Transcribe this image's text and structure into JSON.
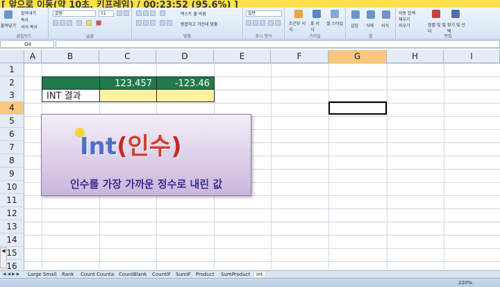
{
  "recording_title": "[ 앞으로 이동(약 10초, 키프레임) / 00:23:52 (95.6%) ]",
  "ribbon": {
    "clipboard": {
      "paste": "붙여넣기",
      "cut": "잘라내기",
      "copy": "복사",
      "format_painter": "서식 복사",
      "label": "클립보드"
    },
    "font": {
      "font_name": "굴림",
      "font_size": "11",
      "label": "글꼴"
    },
    "alignment": {
      "wrap_text": "텍스트 줄 바꿈",
      "merge_center": "병합하고 가운데 맞춤",
      "label": "맞춤"
    },
    "number": {
      "format": "일반",
      "label": "표시 형식"
    },
    "styles": {
      "conditional": "조건부 서식",
      "table": "표 서식",
      "cell": "셀 스타일",
      "label": "스타일"
    },
    "cells": {
      "insert": "삽입",
      "delete": "삭제",
      "format": "서식",
      "label": "셀"
    },
    "editing": {
      "autosum": "자동 합계",
      "fill": "채우기",
      "clear": "지우기",
      "sort": "정렬 및 필터",
      "find": "찾기 및 선택",
      "label": "편집"
    }
  },
  "formula_bar": {
    "name_box": "G4",
    "formula": ""
  },
  "columns": [
    "A",
    "B",
    "C",
    "D",
    "E",
    "F",
    "G",
    "H",
    "I"
  ],
  "rows": [
    "1",
    "2",
    "3",
    "4",
    "5",
    "6",
    "7",
    "8",
    "9",
    "10",
    "11",
    "12",
    "13",
    "14",
    "15",
    "16"
  ],
  "cells": {
    "c2": "123.457",
    "d2": "-123.46",
    "b3": "INT 결과"
  },
  "overlay": {
    "func": "Int",
    "open_paren": "(",
    "arg": "인수",
    "close_paren": ")",
    "description": "인수를 가장 가까운 정수로 내린 값"
  },
  "sheet_tabs": [
    "Large Small",
    "Rank",
    "Count Counta",
    "CountBlank",
    "CountIF",
    "SumIF",
    "Product",
    "SumProduct",
    "Int"
  ],
  "status": {
    "zoom": "220%"
  },
  "colors": {
    "accent_green": "#217a4c",
    "input_yellow": "#fff39e",
    "selected_header": "#f8c780",
    "overlay_purple": "#3a2e90"
  }
}
